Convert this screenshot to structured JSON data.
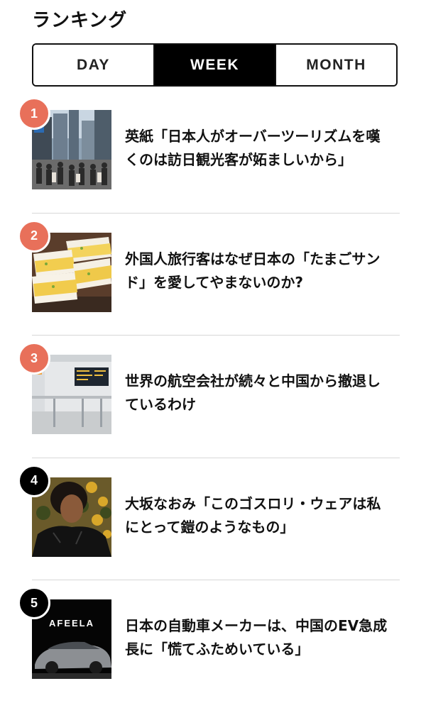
{
  "header": {
    "title": "ランキング"
  },
  "tabs": [
    {
      "label": "DAY",
      "active": false
    },
    {
      "label": "WEEK",
      "active": true
    },
    {
      "label": "MONTH",
      "active": false
    }
  ],
  "colors": {
    "rank_top": "#e8705a",
    "rank_other": "#000000",
    "active_tab_bg": "#000000"
  },
  "articles": [
    {
      "rank": "1",
      "headline": "英紙「日本人がオーバーツーリズムを嘆くのは訪日観光客が妬ましいから」",
      "thumbnail": "tokyo-street-crowd"
    },
    {
      "rank": "2",
      "headline": "外国人旅行客はなぜ日本の「たまごサンド」を愛してやまないのか?",
      "thumbnail": "egg-sandwich"
    },
    {
      "rank": "3",
      "headline": "世界の航空会社が続々と中国から撤退しているわけ",
      "thumbnail": "airport-terminal"
    },
    {
      "rank": "4",
      "headline": "大坂なおみ「このゴスロリ・ウェアは私にとって鎧のようなもの」",
      "thumbnail": "athlete-portrait"
    },
    {
      "rank": "5",
      "headline": "日本の自動車メーカーは、中国のEV急成長に「慌てふためいている」",
      "thumbnail": "afeela-car",
      "thumbnail_text": "AFEELA"
    }
  ]
}
